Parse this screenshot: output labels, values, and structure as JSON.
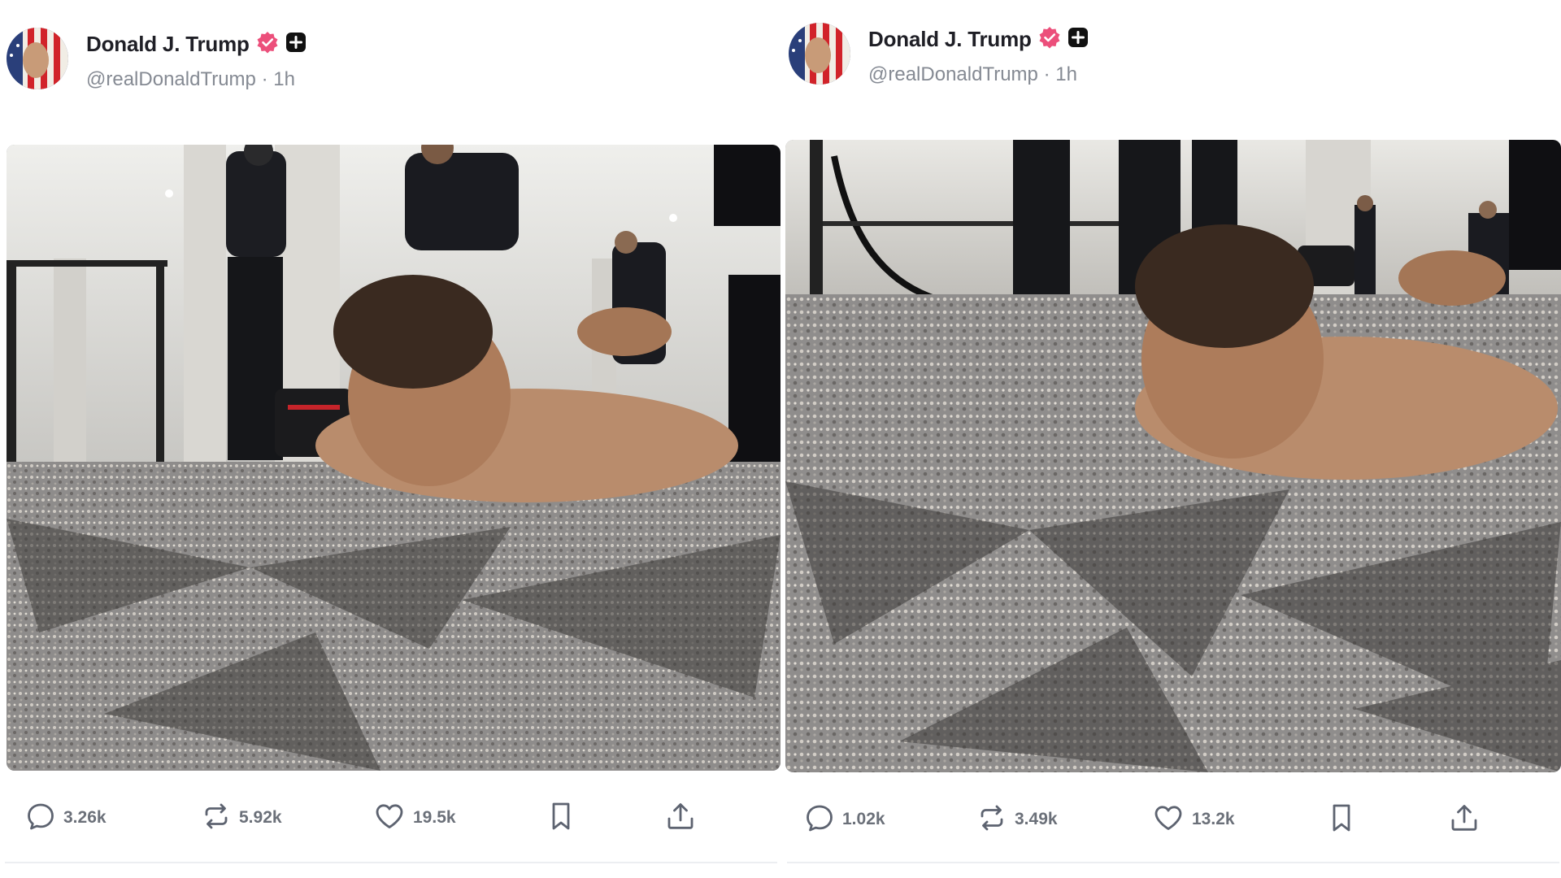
{
  "posts": [
    {
      "author": {
        "display_name": "Donald J. Trump",
        "handle": "@realDonaldTrump",
        "separator": "·",
        "time": "1h"
      },
      "stats": {
        "replies": "3.26k",
        "retruths": "5.92k",
        "likes": "19.5k"
      }
    },
    {
      "author": {
        "display_name": "Donald J. Trump",
        "handle": "@realDonaldTrump",
        "separator": "·",
        "time": "1h"
      },
      "stats": {
        "replies": "1.02k",
        "retruths": "3.49k",
        "likes": "13.2k"
      }
    }
  ],
  "icons": {
    "verified": "verified-badge-icon",
    "plus": "plus-square-icon",
    "reply": "reply-bubble-icon",
    "retruth": "repost-arrows-icon",
    "like": "heart-icon",
    "bookmark": "bookmark-icon",
    "share": "share-upload-icon"
  },
  "colors": {
    "verified_badge": "#ec4f7b",
    "text_primary": "#1f1f26",
    "text_secondary": "#858a93",
    "icon_gray": "#5d6370"
  }
}
